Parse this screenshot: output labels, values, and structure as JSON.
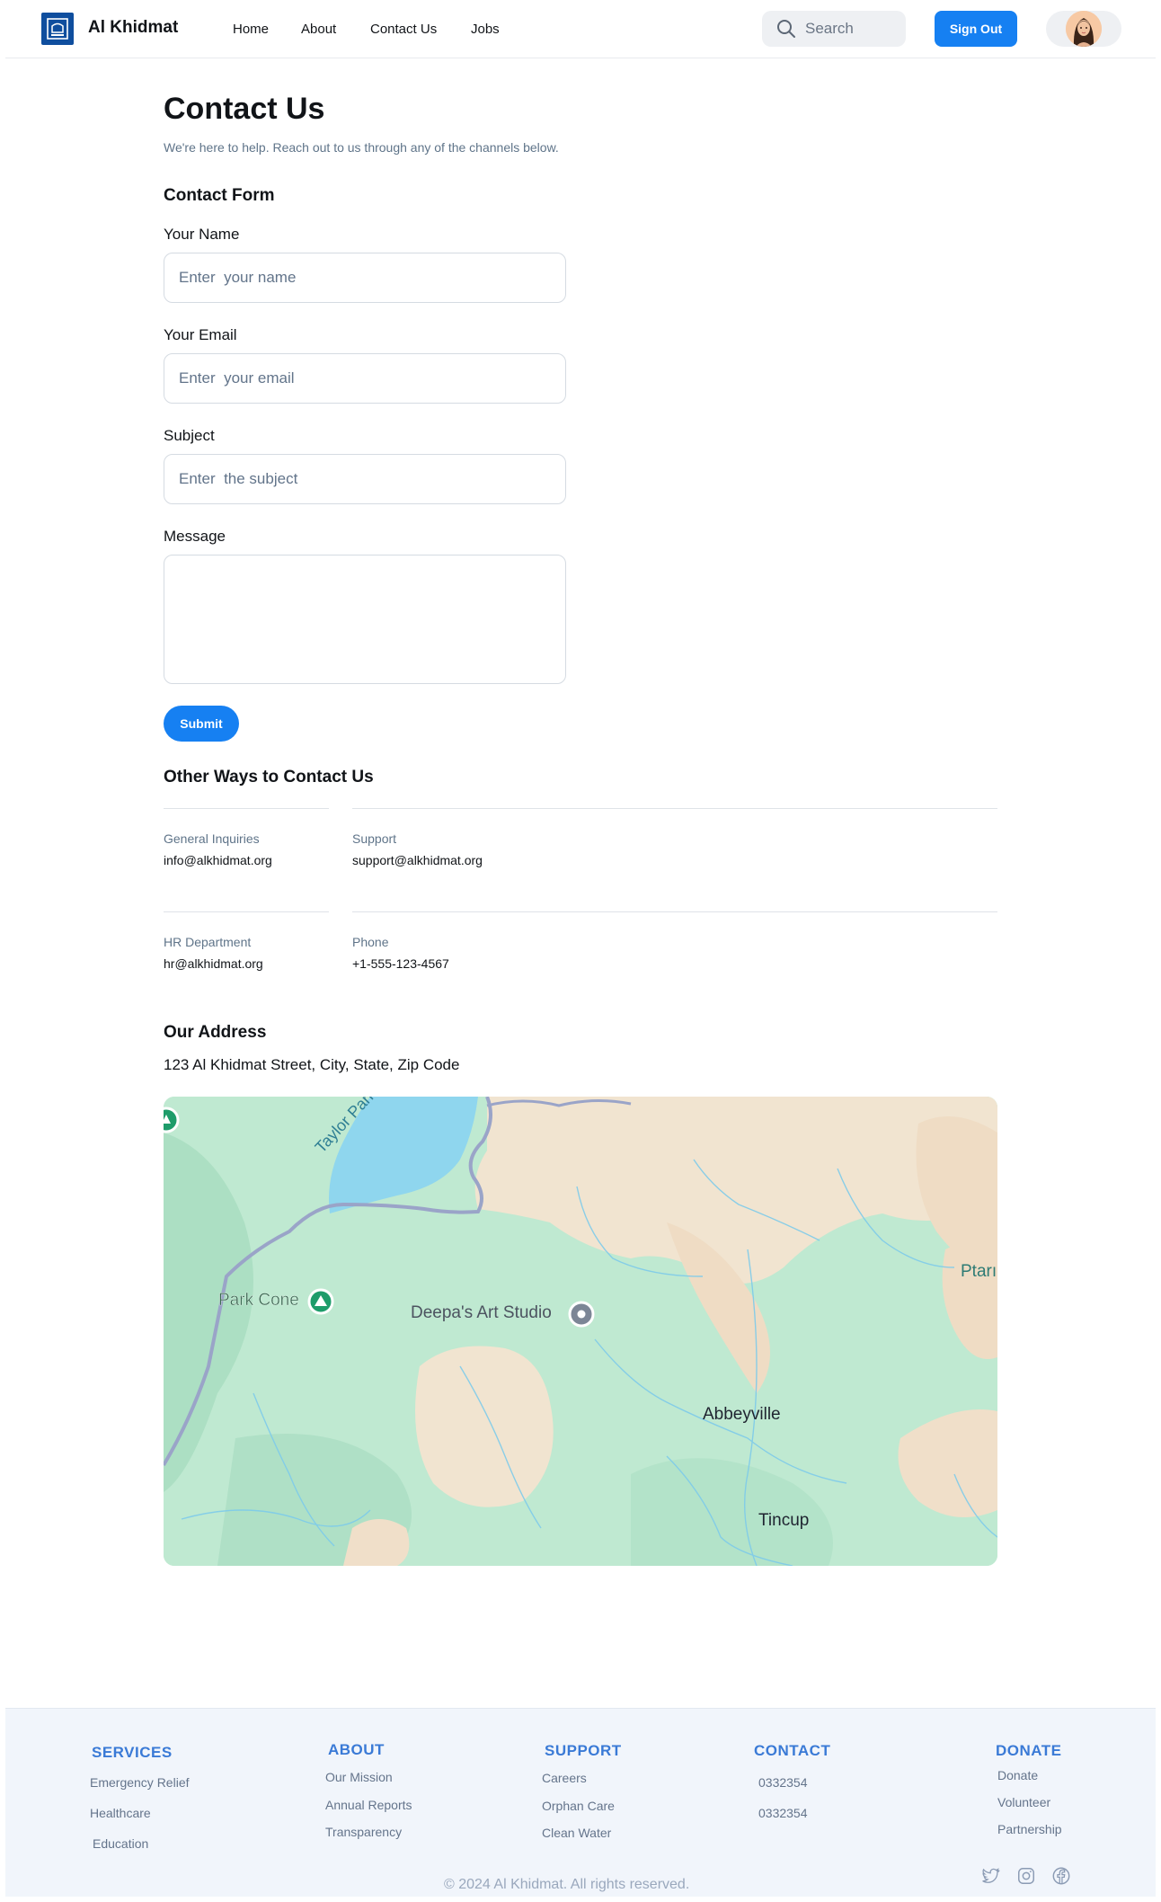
{
  "nav": {
    "brand": "Al Khidmat",
    "links": [
      "Home",
      "About",
      "Contact Us",
      "Jobs"
    ],
    "search_placeholder": "Search",
    "sign_out": "Sign Out"
  },
  "page": {
    "title": "Contact Us",
    "subtitle": "We're here to help. Reach out to us through any of the channels below."
  },
  "form": {
    "heading": "Contact Form",
    "name_label": "Your Name",
    "name_placeholder": "Enter  your name",
    "email_label": "Your Email",
    "email_placeholder": "Enter  your email",
    "subject_label": "Subject",
    "subject_placeholder": "Enter  the subject",
    "message_label": "Message",
    "message_value": "",
    "submit": "Submit"
  },
  "other_ways": {
    "heading": "Other Ways to Contact Us",
    "items": [
      {
        "label": "General Inquiries",
        "value": "info@alkhidmat.org"
      },
      {
        "label": "Support",
        "value": "support@alkhidmat.org"
      },
      {
        "label": "HR Department",
        "value": "hr@alkhidmat.org"
      },
      {
        "label": "Phone",
        "value": "+1-555-123-4567"
      }
    ]
  },
  "address": {
    "heading": "Our Address",
    "value": "123 Al Khidmat Street, City, State, Zip Code"
  },
  "map": {
    "labels": [
      "Taylor Park Reser",
      "Park Cone",
      "Deepa's Art Studio",
      "Abbeyville",
      "Tincup",
      "Ptarı"
    ]
  },
  "footer": {
    "services": {
      "heading": "SERVICES",
      "links": [
        "Emergency Relief",
        "Healthcare",
        "Education"
      ]
    },
    "about": {
      "heading": "ABOUT",
      "links": [
        "Our Mission",
        "Annual Reports",
        "Transparency"
      ]
    },
    "support": {
      "heading": "SUPPORT",
      "links": [
        "Careers",
        "Orphan Care",
        "Clean Water"
      ]
    },
    "contact": {
      "heading": "CONTACT",
      "links": [
        "0332354",
        "0332354"
      ]
    },
    "donate": {
      "heading": "DONATE",
      "links": [
        "Donate",
        "Volunteer",
        "Partnership"
      ]
    },
    "copyright": "© 2024 Al Khidmat. All rights reserved.",
    "social_icons": [
      "twitter-icon",
      "instagram-icon",
      "facebook-icon"
    ]
  },
  "colors": {
    "accent": "#1680f2",
    "footer_heading": "#3a7ad6",
    "map_green": "#bfe9d1",
    "map_tan": "#f1e4d0",
    "map_water": "#8fd6ee"
  }
}
